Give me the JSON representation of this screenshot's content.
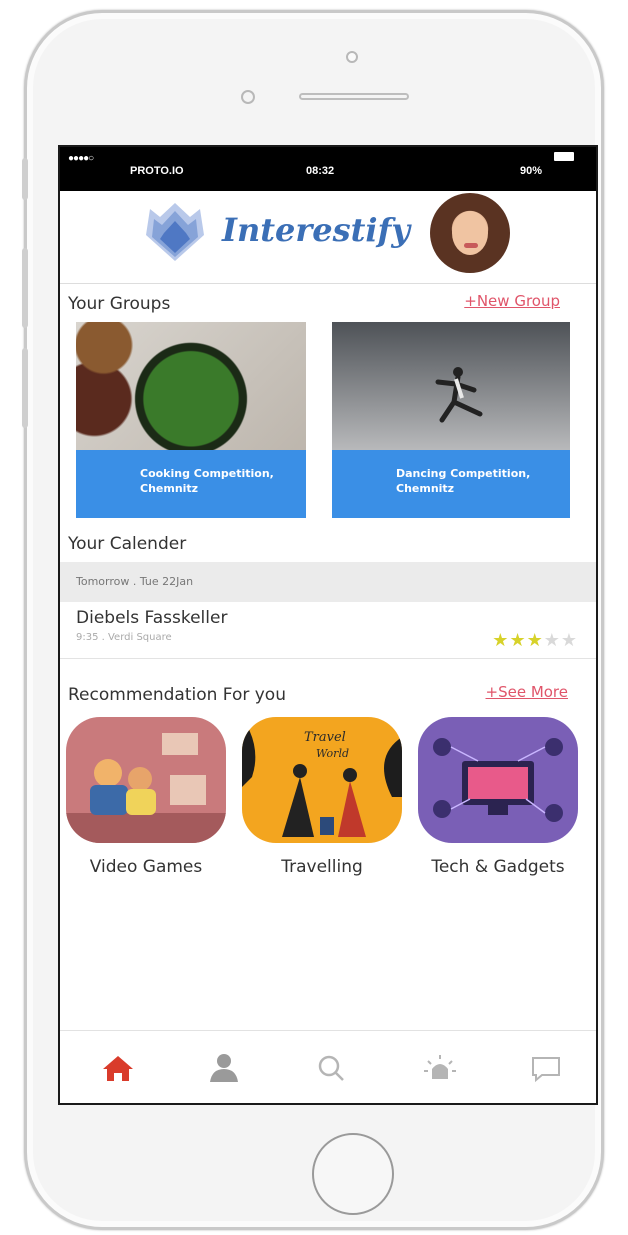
{
  "status_bar": {
    "signal": "●●●●○",
    "carrier": "PROTO.IO",
    "time": "08:32",
    "battery": "90%"
  },
  "header": {
    "app_name": "Interestify",
    "logo_icon": "layered-lotus-logo",
    "avatar": "user-avatar"
  },
  "groups": {
    "title": "Your Groups",
    "new_group_link": "+New Group",
    "cards": [
      {
        "caption_line1": "Cooking Competition,",
        "caption_line2": "Chemnitz",
        "image": "cooking-photo"
      },
      {
        "caption_line1": "Dancing Competition,",
        "caption_line2": "Chemnitz",
        "image": "dancer-photo"
      }
    ]
  },
  "calendar": {
    "title": "Your Calender",
    "date": "Tomorrow . Tue 22Jan",
    "event": {
      "name": "Diebels Fasskeller",
      "details": "9:35 . Verdi Square",
      "rating_filled": 3,
      "rating_max": 5
    }
  },
  "recommendations": {
    "title": "Recommendation For you",
    "see_more_link": "+See More",
    "items": [
      {
        "label": "Video Games",
        "image": "gamers-illustration"
      },
      {
        "label": "Travelling",
        "image": "travel-the-world-illustration"
      },
      {
        "label": "Tech  & Gadgets",
        "image": "tech-gadgets-illustration"
      }
    ]
  },
  "tab_bar": {
    "items": [
      {
        "name": "home",
        "icon": "home-icon",
        "active": true
      },
      {
        "name": "profile",
        "icon": "person-icon",
        "active": false
      },
      {
        "name": "search",
        "icon": "search-icon",
        "active": false
      },
      {
        "name": "alerts",
        "icon": "alarm-light-icon",
        "active": false
      },
      {
        "name": "messages",
        "icon": "chat-bubble-icon",
        "active": false
      }
    ]
  },
  "colors": {
    "accent_red": "#d93b2b",
    "link_pink": "#e0556a",
    "card_blue": "#3a8fe6",
    "brand_blue": "#3b6fb6",
    "star_yellow": "#d7d22a"
  }
}
